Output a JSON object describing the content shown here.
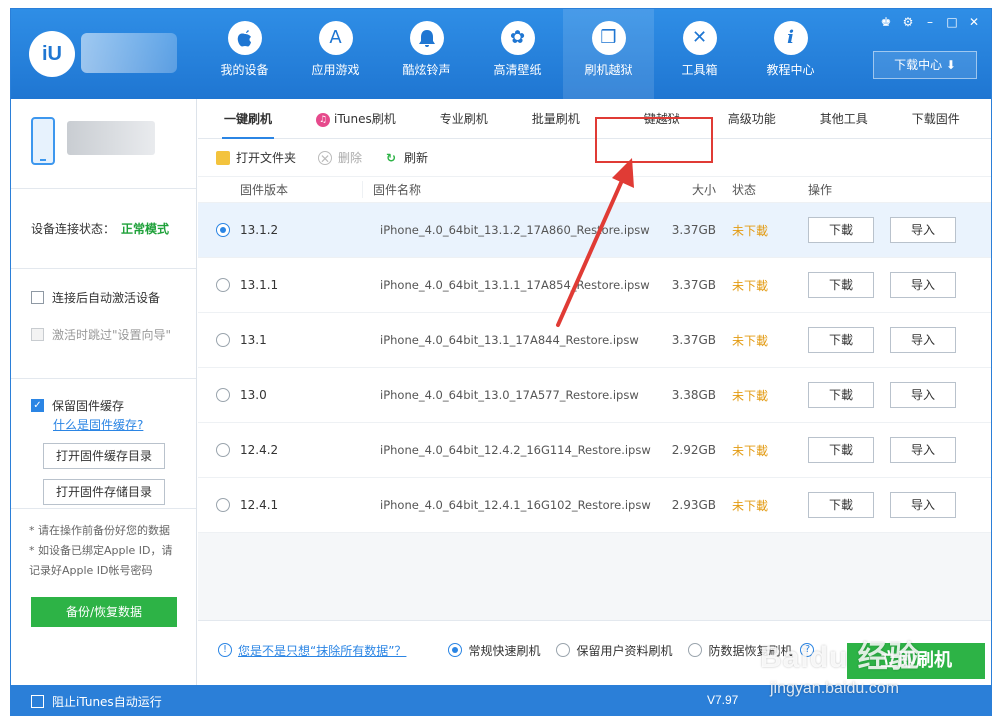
{
  "app": {
    "logo_text": "iU",
    "window_controls": [
      "♚",
      "⚙",
      "–",
      "□",
      "✕"
    ],
    "download_center": "下载中心 ⬇"
  },
  "nav": [
    {
      "label": "我的设备",
      "icon": "apple-icon",
      "glyph": ""
    },
    {
      "label": "应用游戏",
      "icon": "app-store-icon",
      "glyph": "A"
    },
    {
      "label": "酷炫铃声",
      "icon": "bell-icon",
      "glyph": "♪"
    },
    {
      "label": "高清壁纸",
      "icon": "flower-icon",
      "glyph": "✿"
    },
    {
      "label": "刷机越狱",
      "icon": "box-icon",
      "glyph": "❒"
    },
    {
      "label": "工具箱",
      "icon": "tools-icon",
      "glyph": "✕"
    },
    {
      "label": "教程中心",
      "icon": "info-icon",
      "glyph": "i"
    }
  ],
  "left": {
    "status_label": "设备连接状态：",
    "status_value": "正常模式",
    "option_auto_activate": "连接后自动激活设备",
    "option_skip_wizard": "激活时跳过\"设置向导\"",
    "keep_cache": "保留固件缓存",
    "what_is_cache": "什么是固件缓存?",
    "open_cache_dir": "打开固件缓存目录",
    "open_storage_dir": "打开固件存储目录",
    "note1": "* 请在操作前备份好您的数据",
    "note2": "* 如设备已绑定Apple ID，请",
    "note3": "  记录好Apple ID帐号密码",
    "backup_button": "备份/恢复数据"
  },
  "tabs": [
    "一键刷机",
    "iTunes刷机",
    "专业刷机",
    "批量刷机",
    "一键越狱",
    "高级功能",
    "其他工具",
    "下载固件"
  ],
  "toolbar": {
    "open_folder": "打开文件夹",
    "delete": "删除",
    "refresh": "刷新"
  },
  "table": {
    "headers": {
      "version": "固件版本",
      "name": "固件名称",
      "size": "大小",
      "status": "状态",
      "ops": "操作"
    },
    "download_label": "下載",
    "import_label": "导入",
    "rows": [
      {
        "version": "13.1.2",
        "name": "iPhone_4.0_64bit_13.1.2_17A860_Restore.ipsw",
        "size": "3.37GB",
        "status": "未下載",
        "selected": true
      },
      {
        "version": "13.1.1",
        "name": "iPhone_4.0_64bit_13.1.1_17A854_Restore.ipsw",
        "size": "3.37GB",
        "status": "未下載",
        "selected": false
      },
      {
        "version": "13.1",
        "name": "iPhone_4.0_64bit_13.1_17A844_Restore.ipsw",
        "size": "3.37GB",
        "status": "未下載",
        "selected": false
      },
      {
        "version": "13.0",
        "name": "iPhone_4.0_64bit_13.0_17A577_Restore.ipsw",
        "size": "3.38GB",
        "status": "未下載",
        "selected": false
      },
      {
        "version": "12.4.2",
        "name": "iPhone_4.0_64bit_12.4.2_16G114_Restore.ipsw",
        "size": "2.92GB",
        "status": "未下載",
        "selected": false
      },
      {
        "version": "12.4.1",
        "name": "iPhone_4.0_64bit_12.4.1_16G102_Restore.ipsw",
        "size": "2.93GB",
        "status": "未下載",
        "selected": false
      }
    ]
  },
  "footer": {
    "help_link": "您是不是只想“抹除所有数据”？",
    "opt_quick": "常规快速刷机",
    "opt_keep_data": "保留用户资料刷机",
    "opt_anti_recovery": "防数据恢复刷机",
    "flash_button": "立即刷机"
  },
  "bottom": {
    "block_itunes": "阻止iTunes自动运行",
    "version": "V7.97"
  },
  "watermark": {
    "logo": "Baidu 经验",
    "url": "jingyan.baidu.com"
  },
  "colors": {
    "brand_blue": "#2b7fd8",
    "ok_green": "#1fa13a",
    "status_orange": "#e39b12",
    "annotation_red": "#e03b35"
  }
}
